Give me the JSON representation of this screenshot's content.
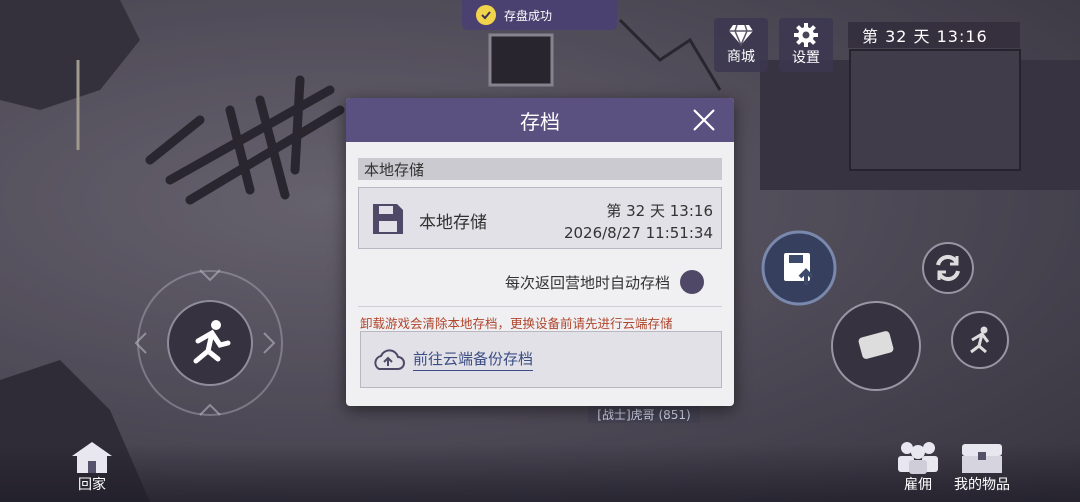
{
  "toast": {
    "text": "存盘成功"
  },
  "top_right": {
    "shop_label": "商城",
    "settings_label": "设置",
    "day_time": "第 32 天  13:16"
  },
  "bottom": {
    "home_label": "回家",
    "hire_label": "雇佣",
    "items_label": "我的物品"
  },
  "player_tag": "[战士]虎哥 (851)",
  "dialog": {
    "title": "存档",
    "section_title": "本地存储",
    "slot": {
      "name": "本地存储",
      "day_time": "第 32 天  13:16",
      "datetime": "2026/8/27 11:51:34"
    },
    "auto_save_label": "每次返回营地时自动存档",
    "warning": "卸载游戏会清除本地存档，更换设备前请先进行云端存储",
    "cloud_button_label": "前往云端备份存档"
  },
  "colors": {
    "header": "#5a5180",
    "warning": "#b0462d",
    "link": "#3c4d83",
    "toast_check": "#f2d34c"
  }
}
